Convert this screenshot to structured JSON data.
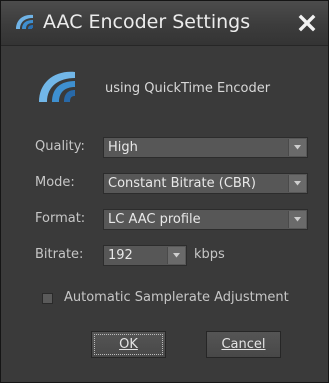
{
  "window": {
    "title": "AAC Encoder Settings",
    "close_icon": "close-x-icon"
  },
  "encoder_info": "using QuickTime Encoder",
  "fields": {
    "quality": {
      "label": "Quality:",
      "value": "High"
    },
    "mode": {
      "label": "Mode:",
      "value": "Constant Bitrate (CBR)"
    },
    "format": {
      "label": "Format:",
      "value": "LC AAC profile"
    },
    "bitrate": {
      "label": "Bitrate:",
      "value": "192",
      "unit": "kbps"
    }
  },
  "options": {
    "auto_samplerate": {
      "label": "Automatic Samplerate Adjustment",
      "checked": false
    }
  },
  "buttons": {
    "ok": "OK",
    "cancel": "Cancel"
  },
  "colors": {
    "window_bg": "#3a3a3a",
    "titlebar_bg": "#444444",
    "logo_blue": "#4a9ad6"
  }
}
